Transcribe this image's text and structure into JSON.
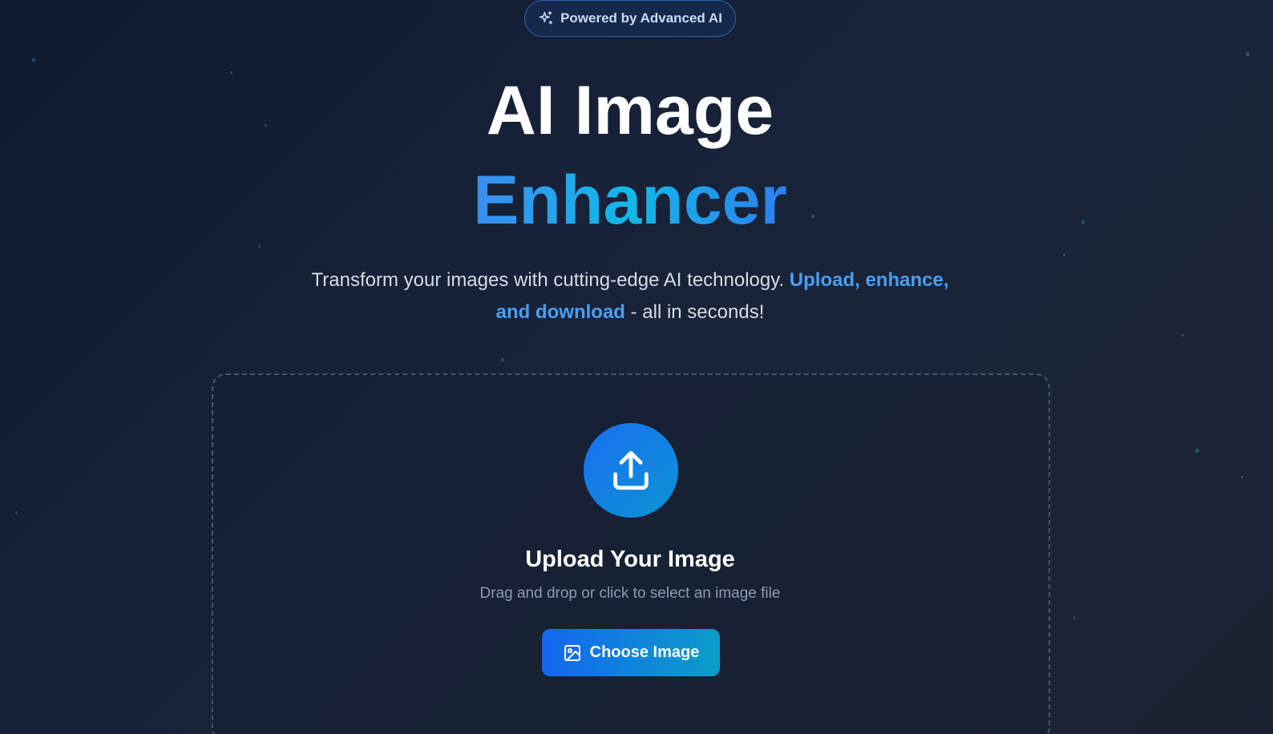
{
  "badge": {
    "label": "Powered by Advanced AI",
    "icon": "sparkles-icon"
  },
  "hero": {
    "title_line1": "AI Image",
    "title_line2": "Enhancer",
    "subtitle_part1": "Transform your images with cutting-edge AI technology. ",
    "subtitle_highlight": "Upload, enhance, and download",
    "subtitle_part2": " - all in seconds!"
  },
  "upload": {
    "icon": "upload-icon",
    "title": "Upload Your Image",
    "hint": "Drag and drop or click to select an image file",
    "button_label": "Choose Image",
    "button_icon": "image-icon"
  },
  "colors": {
    "background": "#172238",
    "accent_blue": "#1466f0",
    "accent_cyan": "#0b9ec9",
    "highlight_text": "#4a9ef0"
  }
}
